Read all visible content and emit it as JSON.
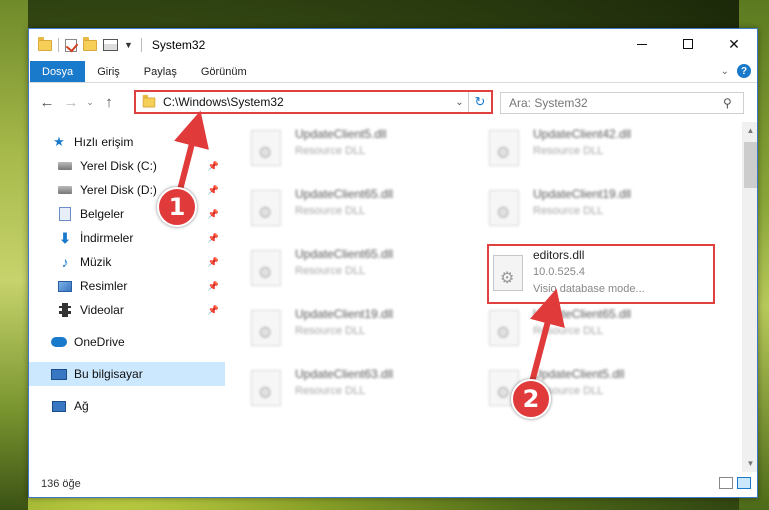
{
  "window": {
    "title": "System32"
  },
  "ribbon": {
    "tabs": [
      {
        "label": "Dosya",
        "active": true
      },
      {
        "label": "Giriş"
      },
      {
        "label": "Paylaş"
      },
      {
        "label": "Görünüm"
      }
    ]
  },
  "address": {
    "path": "C:\\Windows\\System32"
  },
  "search": {
    "placeholder": "Ara: System32"
  },
  "sidebar": {
    "items": [
      {
        "label": "Hızlı erişim"
      },
      {
        "label": "Yerel Disk (C:)"
      },
      {
        "label": "Yerel Disk (D:)"
      },
      {
        "label": "Belgeler"
      },
      {
        "label": "İndirmeler"
      },
      {
        "label": "Müzik"
      },
      {
        "label": "Resimler"
      },
      {
        "label": "Videolar"
      },
      {
        "label": "OneDrive"
      },
      {
        "label": "Bu bilgisayar"
      },
      {
        "label": "Ağ"
      }
    ]
  },
  "files": [
    {
      "name": "UpdateClient5.dll",
      "sub": "Resource DLL"
    },
    {
      "name": "UpdateClient42.dll",
      "sub": "Resource DLL"
    },
    {
      "name": "UpdateClient65.dll",
      "sub": "Resource DLL"
    },
    {
      "name": "UpdateClient19.dll",
      "sub": "Resource DLL"
    },
    {
      "name": "UpdateClient65.dll",
      "sub": "Resource DLL"
    },
    {
      "name": "editors.dll",
      "sub": "10.0.525.4",
      "sub2": "Visio database mode..."
    },
    {
      "name": "UpdateClient19.dll",
      "sub": "Resource DLL"
    },
    {
      "name": "UpdateClient65.dll",
      "sub": "Resource DLL"
    },
    {
      "name": "UpdateClient63.dll",
      "sub": "Resource DLL"
    },
    {
      "name": "UpdateClient5.dll",
      "sub": "Resource DLL"
    }
  ],
  "status": {
    "count": "136 öğe"
  },
  "annotations": {
    "one": "1",
    "two": "2"
  },
  "colors": {
    "accent": "#1979ca",
    "highlight": "#e04040",
    "selected": "#cce8ff"
  }
}
